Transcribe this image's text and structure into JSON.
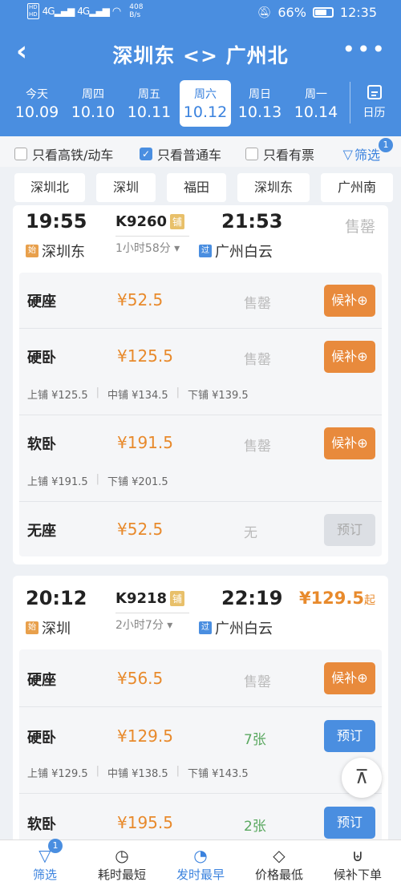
{
  "status_bar": {
    "network_speed": "408",
    "network_unit": "B/s",
    "battery": "66%",
    "time": "12:35",
    "hd1": "HD",
    "hd2": "HD",
    "sig1": "4G",
    "sig2": "4G"
  },
  "header": {
    "back_icon": "‹",
    "title": "深圳东 <> 广州北",
    "more_icon": "•••"
  },
  "dates": [
    {
      "weekday": "今天",
      "date": "10.09"
    },
    {
      "weekday": "周四",
      "date": "10.10"
    },
    {
      "weekday": "周五",
      "date": "10.11"
    },
    {
      "weekday": "周六",
      "date": "10.12"
    },
    {
      "weekday": "周日",
      "date": "10.13"
    },
    {
      "weekday": "周一",
      "date": "10.14"
    }
  ],
  "calendar_label": "日历",
  "filters": {
    "high_speed": "只看高铁/动车",
    "regular": "只看普通车",
    "has_ticket": "只看有票",
    "sift": "筛选",
    "sift_badge": "1"
  },
  "stations": [
    "深圳北",
    "深圳",
    "福田",
    "深圳东",
    "广州南"
  ],
  "trains": [
    {
      "dep_time": "19:55",
      "train_no": "K9260",
      "pu_tag": "铺",
      "arr_time": "21:53",
      "duration": "1小时58分 ▾",
      "dep_tag": "始",
      "dep_station": "深圳东",
      "arr_tag": "过",
      "arr_station": "广州白云",
      "status": "售罄",
      "seats": [
        {
          "name": "硬座",
          "price": "¥52.5",
          "avail": "售罄",
          "button": "候补⊕"
        },
        {
          "name": "硬卧",
          "price": "¥125.5",
          "avail": "售罄",
          "button": "候补⊕",
          "berths": [
            "上铺 ¥125.5",
            "中铺 ¥134.5",
            "下铺 ¥139.5"
          ]
        },
        {
          "name": "软卧",
          "price": "¥191.5",
          "avail": "售罄",
          "button": "候补⊕",
          "berths": [
            "上铺 ¥191.5",
            "下铺 ¥201.5"
          ]
        },
        {
          "name": "无座",
          "price": "¥52.5",
          "avail": "无",
          "button": "预订"
        }
      ]
    },
    {
      "dep_time": "20:12",
      "train_no": "K9218",
      "pu_tag": "铺",
      "arr_time": "22:19",
      "duration": "2小时7分 ▾",
      "dep_tag": "始",
      "dep_station": "深圳",
      "arr_tag": "过",
      "arr_station": "广州白云",
      "price_from": "¥129.5",
      "price_suffix": "起",
      "seats": [
        {
          "name": "硬座",
          "price": "¥56.5",
          "avail": "售罄",
          "button": "候补⊕"
        },
        {
          "name": "硬卧",
          "price": "¥129.5",
          "avail": "7张",
          "button": "预订",
          "berths": [
            "上铺 ¥129.5",
            "中铺 ¥138.5",
            "下铺 ¥143.5"
          ]
        },
        {
          "name": "软卧",
          "price": "¥195.5",
          "avail": "2张",
          "button": "预订"
        }
      ]
    }
  ],
  "to_top_icon": "⊼",
  "bottom_tabs": [
    {
      "icon": "filter-icon",
      "label": "筛选",
      "badge": "1"
    },
    {
      "icon": "timer-icon",
      "label": "耗时最短"
    },
    {
      "icon": "clock-24-icon",
      "label": "发时最早"
    },
    {
      "icon": "price-tag-icon",
      "label": "价格最低"
    },
    {
      "icon": "cart-icon",
      "label": "候补下单"
    }
  ]
}
